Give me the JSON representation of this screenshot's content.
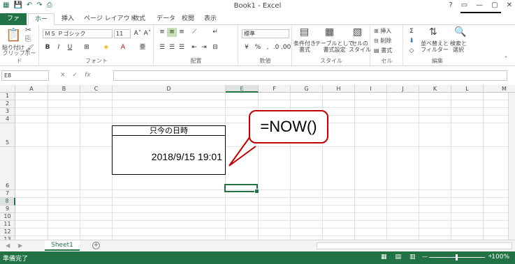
{
  "window": {
    "title": "Book1 - Excel"
  },
  "tabs": [
    {
      "label": "ファイル"
    },
    {
      "label": "ホーム"
    },
    {
      "label": "挿入"
    },
    {
      "label": "ページ レイアウト"
    },
    {
      "label": "数式"
    },
    {
      "label": "データ"
    },
    {
      "label": "校閲"
    },
    {
      "label": "表示"
    }
  ],
  "ribbon": {
    "clipboard": {
      "paste": "貼り付け",
      "label": "クリップボード"
    },
    "font": {
      "name": "ＭＳ Ｐゴシック",
      "size": "11",
      "label": "フォント"
    },
    "alignment": {
      "label": "配置"
    },
    "number": {
      "format": "標準",
      "label": "数値"
    },
    "styles": {
      "cond": "条件付き\n書式",
      "table": "テーブルとして\n書式設定",
      "cell": "セルの\nスタイル",
      "label": "スタイル"
    },
    "cells": {
      "insert": "挿入",
      "delete": "削除",
      "format": "書式",
      "label": "セル"
    },
    "edit": {
      "sort": "並べ替えと\nフィルター",
      "find": "検索と\n選択",
      "label": "編集"
    }
  },
  "formula_bar": {
    "namebox": "E8",
    "value": ""
  },
  "columns": [
    "A",
    "B",
    "C",
    "D",
    "E",
    "F",
    "G",
    "H",
    "I",
    "J",
    "K",
    "L",
    "M"
  ],
  "rows": [
    "1",
    "2",
    "3",
    "4",
    "5",
    "6",
    "7",
    "8",
    "9",
    "10",
    "11",
    "12",
    "13",
    "14",
    "15"
  ],
  "cells": {
    "d5": "只今の日時",
    "d6": "2018/9/15 19:01"
  },
  "callout": "=NOW()",
  "sheets": [
    {
      "name": "Sheet1"
    }
  ],
  "status": {
    "ready": "準備完了",
    "zoom": "100%"
  }
}
